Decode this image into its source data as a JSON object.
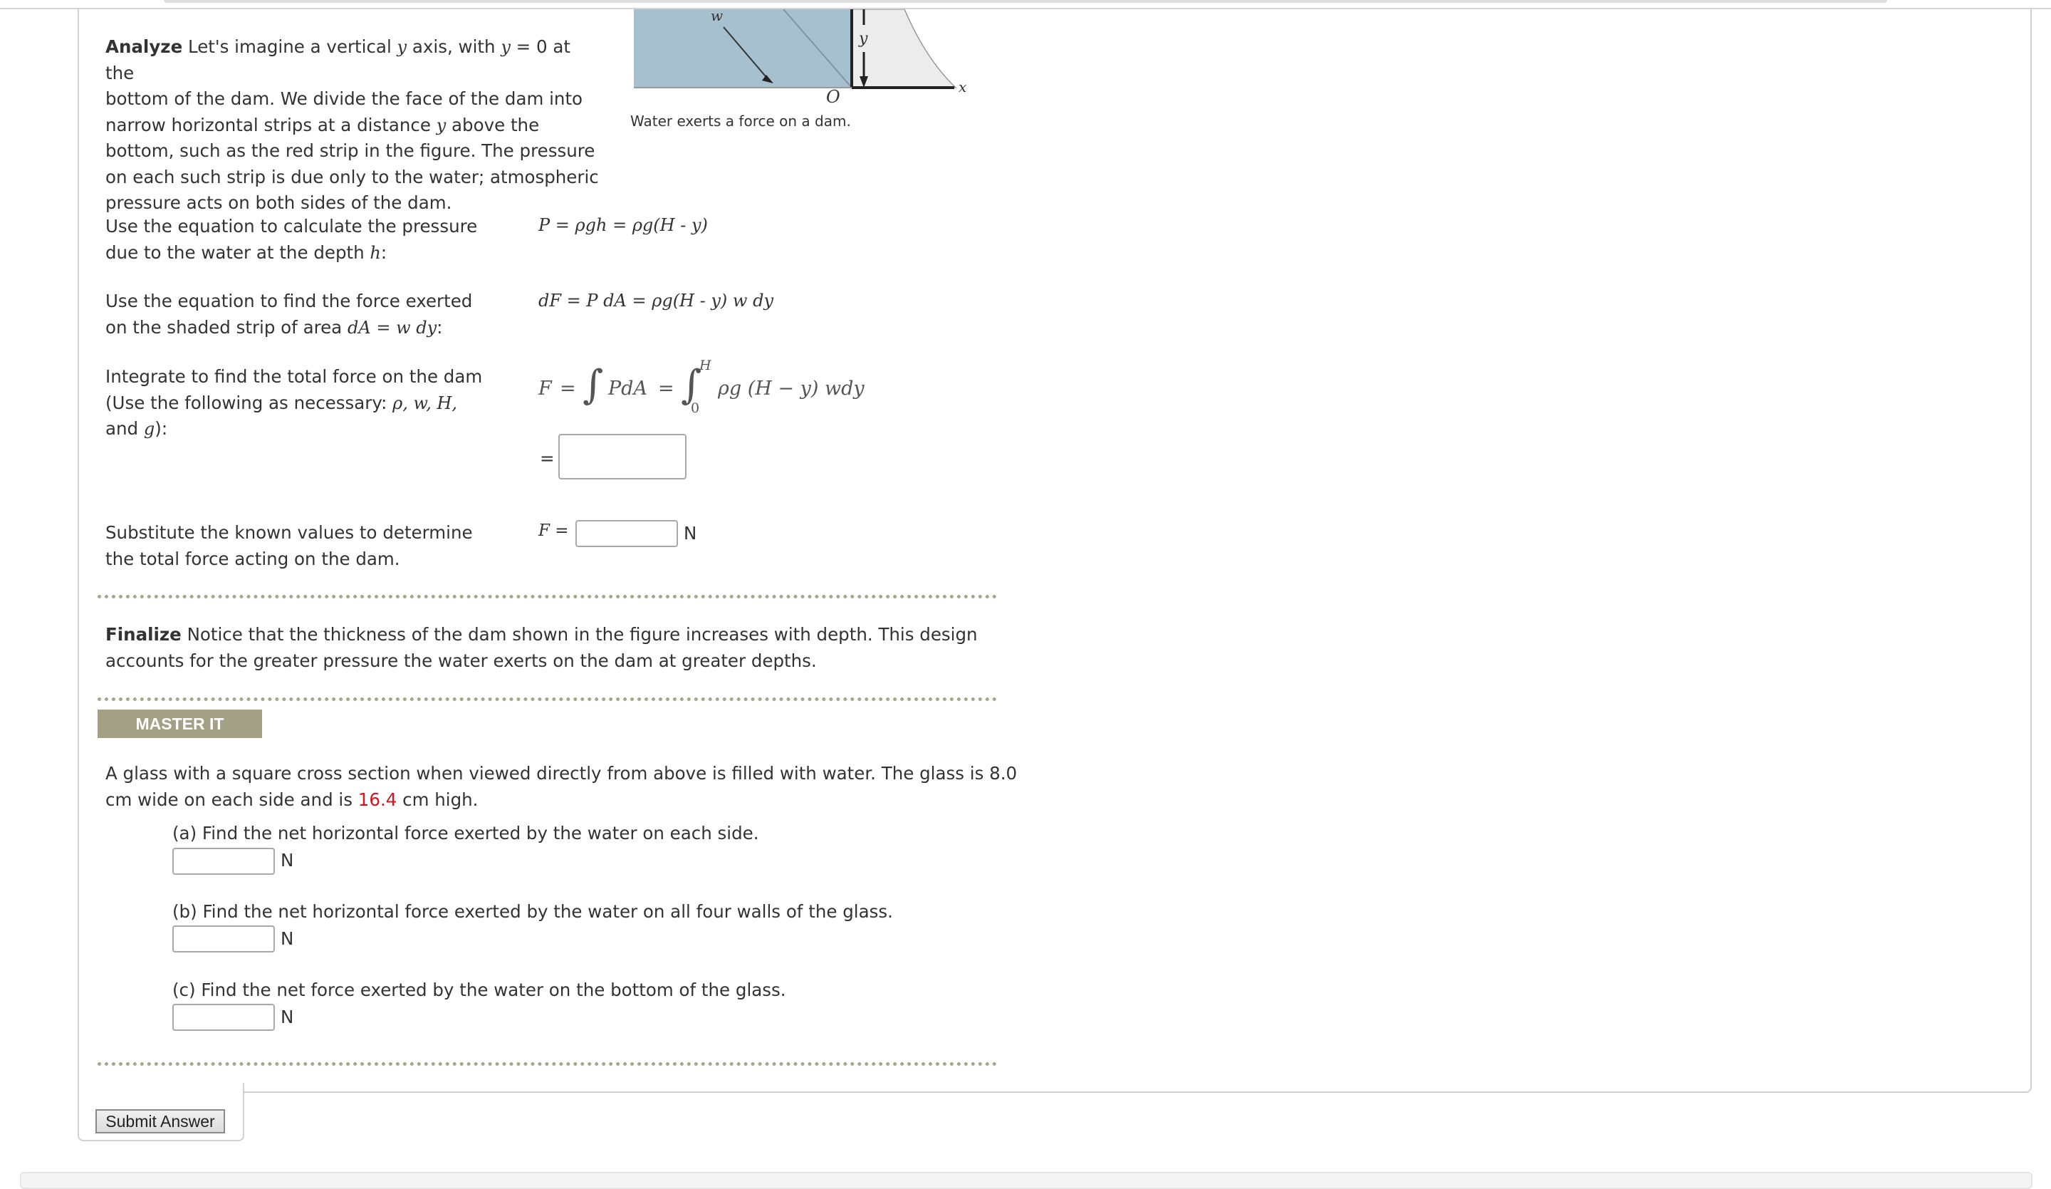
{
  "analyze": {
    "label": "Analyze",
    "lines": [
      [
        "Let's imagine a vertical ",
        "y",
        " axis, with ",
        "y",
        " = 0 at the"
      ],
      [
        "bottom of the dam. We divide the face of the dam into"
      ],
      [
        "narrow horizontal strips at a distance ",
        "y",
        " above the"
      ],
      [
        "bottom, such as the red strip in the figure. The pressure"
      ],
      [
        "on each such strip is due only to the water; atmospheric"
      ],
      [
        "pressure acts on both sides of the dam."
      ]
    ]
  },
  "figure": {
    "caption": "Water exerts a force on a dam.",
    "labels": {
      "w": "w",
      "y": "y",
      "origin": "O",
      "x": "x"
    },
    "colors": {
      "water": "#a7c0cf",
      "dam": "#ececec"
    }
  },
  "steps": [
    {
      "prompt_line1": "Use the equation to calculate the pressure",
      "prompt_line2_pre": "due to the water at the depth ",
      "prompt_line2_var": "h",
      "prompt_line2_post": ":",
      "equation": "P = ρgh = ρg(H - y)"
    },
    {
      "prompt_line1": "Use the equation to find the force exerted",
      "prompt_line2_pre": "on the shaded strip of area ",
      "prompt_line2_var": "dA = w dy",
      "prompt_line2_post": ":",
      "equation": "dF = P dA = ρg(H - y) w dy"
    },
    {
      "prompt_line1": "Integrate to find the total force on the dam",
      "prompt_line2_pre": "(Use the following as necessary: ",
      "prompt_line2_var": "ρ, w, H,",
      "prompt_line3_pre": "and ",
      "prompt_line3_var": "g",
      "prompt_line3_post": "):",
      "equation": {
        "lhs": "F",
        "eq": "=",
        "integrand1": "PdA",
        "upper": "H",
        "lower": "0",
        "integrand2": "ρg (H − y) wdy"
      },
      "answer_prefix": "=",
      "answer_value": ""
    },
    {
      "prompt_line1": "Substitute the known values to determine",
      "prompt_line2_pre": "the total force acting on the dam.",
      "answer_prefix": "F =",
      "answer_value": "",
      "unit": "N"
    }
  ],
  "finalize": {
    "label": "Finalize",
    "line1": "Notice that the thickness of the dam shown in the figure increases with depth. This design",
    "line2": "accounts for the greater pressure the water exerts on the dam at greater depths."
  },
  "master_it": {
    "badge": "MASTER IT",
    "problem_line1": "A glass with a square cross section when viewed directly from above is filled with water. The glass is 8.0",
    "problem_line2_pre": "cm wide on each side and is ",
    "problem_height": "16.4",
    "problem_line2_post": " cm high.",
    "highlight_color": "#e0101a",
    "parts": [
      {
        "label": "(a) Find the net horizontal force exerted by the water on each side.",
        "value": "",
        "unit": "N"
      },
      {
        "label": "(b) Find the net horizontal force exerted by the water on all four walls of the glass.",
        "value": "",
        "unit": "N"
      },
      {
        "label": "(c) Find the net force exerted by the water on the bottom of the glass.",
        "value": "",
        "unit": "N"
      }
    ]
  },
  "submit_label": "Submit Answer"
}
